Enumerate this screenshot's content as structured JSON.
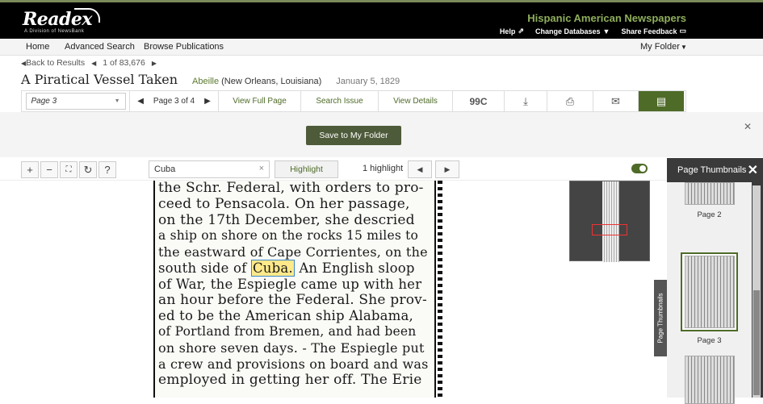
{
  "brand": {
    "logo": "Readex",
    "logo_sub": "A Division of NewsBank",
    "product": "Hispanic American Newspapers"
  },
  "toplinks": {
    "help": "Help",
    "change_db": "Change Databases",
    "share": "Share Feedback"
  },
  "nav": {
    "home": "Home",
    "advanced": "Advanced Search",
    "browse": "Browse Publications",
    "folder": "My Folder"
  },
  "crumbs": {
    "back": "Back to Results",
    "position": "1 of 83,676"
  },
  "article": {
    "title": "A Piratical Vessel Taken",
    "publication": "Abeille",
    "location": "(New Orleans, Louisiana)",
    "date": "January 5, 1829"
  },
  "toolbar": {
    "page_select": "Page 3",
    "page_of": "Page 3 of 4",
    "view_full": "View Full Page",
    "search_issue": "Search Issue",
    "view_details": "View Details",
    "cite_icon": "99C"
  },
  "save": {
    "label": "Save to My Folder"
  },
  "viewer": {
    "search_value": "Cuba",
    "highlight_label": "Highlight",
    "highlight_count": "1 highlight"
  },
  "newspaper": {
    "lines": [
      "the Schr. Federal, with orders to pro-",
      "ceed to Pensacola. On her passage,",
      "on the 17th December, she descried",
      "a ship on shore on the rocks 15 miles to",
      "the eastward of Cape Corrientes, on the",
      "south side of",
      "An English sloop",
      "of War, the Espiegle came up with her",
      "an hour before the Federal. She prov-",
      "ed to be the American ship Alabama,",
      "of Portland from Bremen, and had been",
      "on shore seven days. - The Espiegle put",
      "a crew and provisions on board and was",
      "employed in getting her off. The Erie"
    ],
    "highlight": "Cuba."
  },
  "thumbs": {
    "title": "Page Thumbnails",
    "tab_label": "Page Thumbnails",
    "pages": [
      "Page 2",
      "Page 3"
    ]
  }
}
